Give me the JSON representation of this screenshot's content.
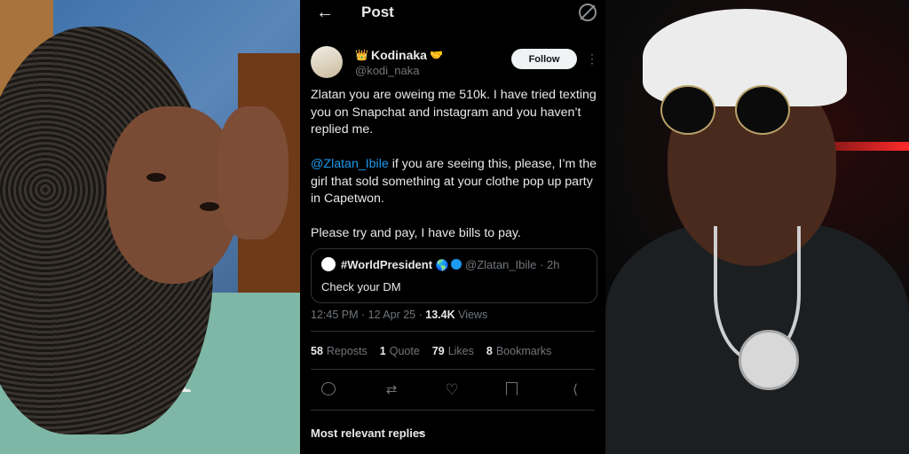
{
  "header": {
    "title": "Post",
    "back_icon": "arrow-left-icon",
    "filter_icon": "filter-icon"
  },
  "author": {
    "name": "Kodinaka",
    "badge_left": "👑",
    "badge_right": "🤝",
    "handle": "@kodi_naka",
    "follow_label": "Follow",
    "more_label": "⋮"
  },
  "post": {
    "paragraph1": "Zlatan you are oweing me 510k. I have tried texting you on Snapchat and instagram and you haven’t replied me.",
    "mention": "@Zlatan_Ibile",
    "paragraph2_rest": " if you are seeing this, please, I’m the girl that sold something at your clothe pop up party in Capetwon.",
    "paragraph3": "Please try and pay, I have bills to pay."
  },
  "quote": {
    "name": "#WorldPresident",
    "globe": "🌎",
    "handle_time": "@Zlatan_Ibile · 2h",
    "text": "Check your DM"
  },
  "meta": {
    "time_date": "12:45 PM · 12 Apr 25 · ",
    "views_count": "13.4K",
    "views_label": " Views"
  },
  "stats": {
    "reposts_n": "58",
    "reposts_label": "Reposts",
    "quotes_n": "1",
    "quotes_label": "Quote",
    "likes_n": "79",
    "likes_label": "Likes",
    "bookmarks_n": "8",
    "bookmarks_label": "Bookmarks"
  },
  "replies": {
    "label": "Most relevant replies",
    "chevron": "⌄"
  },
  "colors": {
    "accent": "#1d9bf0",
    "background": "#000000",
    "muted": "#71767b"
  }
}
